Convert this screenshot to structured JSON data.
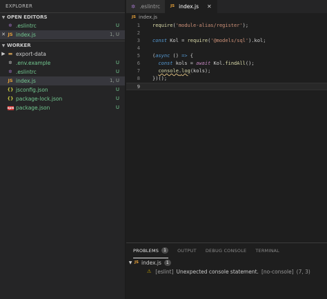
{
  "sidebar": {
    "title": "EXPLORER",
    "open_editors": {
      "label": "OPEN EDITORS",
      "items": [
        {
          "name": ".eslintrc",
          "badge": "U"
        },
        {
          "name": "index.js",
          "badge": "1, U",
          "close": "✕"
        }
      ]
    },
    "worker": {
      "label": "WORKER",
      "items": [
        {
          "name": "export-data",
          "badge": ""
        },
        {
          "name": ".env.example",
          "badge": "U"
        },
        {
          "name": ".eslintrc",
          "badge": "U"
        },
        {
          "name": "index.js",
          "badge": "1, U"
        },
        {
          "name": "jsconfig.json",
          "badge": "U"
        },
        {
          "name": "package-lock.json",
          "badge": "U"
        },
        {
          "name": "package.json",
          "badge": "U"
        }
      ]
    }
  },
  "tabs": [
    {
      "label": ".eslintrc",
      "icon": "gear-icon"
    },
    {
      "label": "index.js",
      "icon": "js-icon",
      "close": "✕"
    }
  ],
  "breadcrumb": {
    "file": "index.js"
  },
  "editor": {
    "line_numbers": [
      "1",
      "2",
      "3",
      "4",
      "5",
      "6",
      "7",
      "8",
      "9"
    ],
    "lines": {
      "l1": {
        "fn": "require",
        "p1": "(",
        "str": "'module-alias/register'",
        "p2": ");"
      },
      "l3": {
        "kw": "const",
        "name": " Kol = ",
        "fn": "require",
        "p1": "(",
        "str": "'@models/sql'",
        "p2": ").kol;"
      },
      "l5": {
        "p1": "(",
        "kw": "async",
        "p2": " () ",
        "arrow": "=>",
        "p3": " {"
      },
      "l6": {
        "kw": "const",
        "name": " kols = ",
        "kw2": "await",
        "obj": " Kol.",
        "fn": "findAll",
        "p": "();"
      },
      "l7": {
        "obj": "console",
        "dot": ".",
        "fn": "log",
        "p1": "(",
        "var": "kols",
        "p2": ");"
      },
      "l8": {
        "text": "})();"
      }
    }
  },
  "panel": {
    "tabs": [
      "PROBLEMS",
      "OUTPUT",
      "DEBUG CONSOLE",
      "TERMINAL"
    ],
    "problems_count": "1",
    "file": {
      "name": "index.js",
      "count": "1"
    },
    "problem": {
      "source": "[eslint]",
      "message": "Unexpected console statement.",
      "rule": "[no-console]",
      "position": "(7, 3)"
    }
  },
  "colors": {
    "accent_green": "#73c991",
    "warning": "#cca700",
    "js": "#e8a23a",
    "json": "#cbcb41"
  }
}
